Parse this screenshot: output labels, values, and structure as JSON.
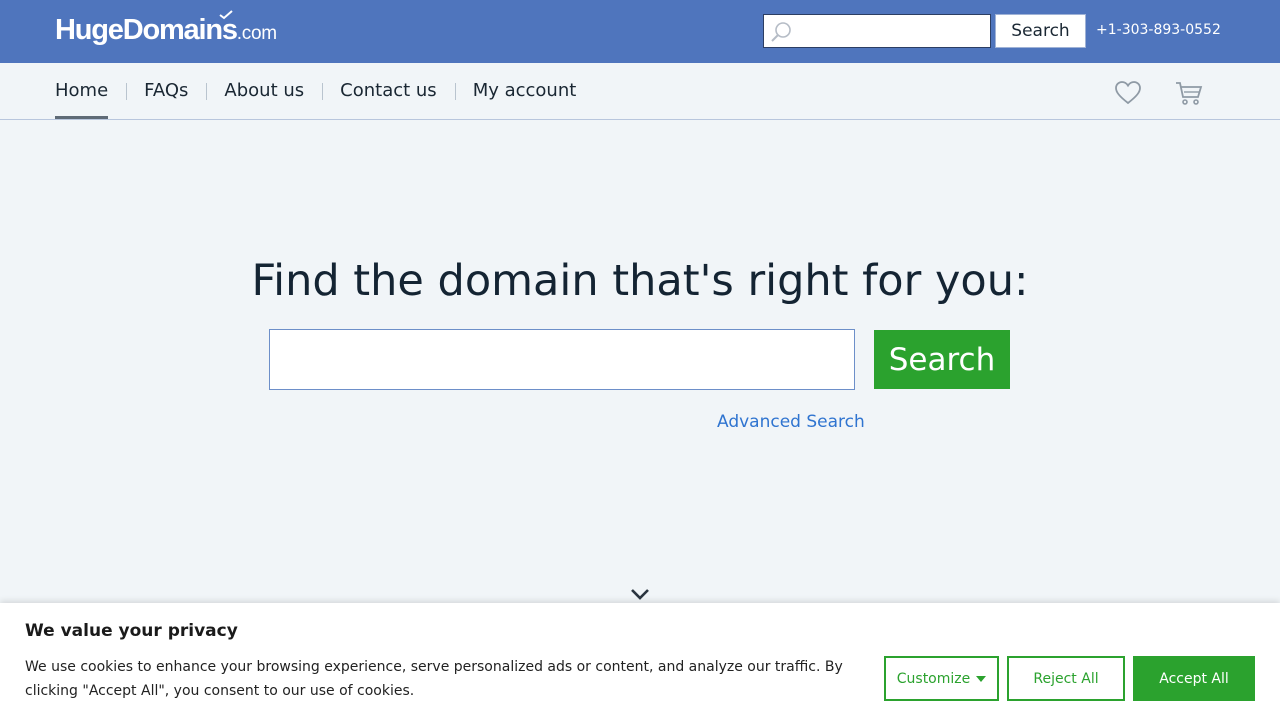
{
  "header": {
    "logo_main": "HugeDomains",
    "logo_suffix": ".com",
    "search_placeholder": "",
    "search_label": "Search",
    "phone": "+1-303-893-0552"
  },
  "nav": {
    "items": [
      {
        "label": "Home",
        "active": true
      },
      {
        "label": "FAQs"
      },
      {
        "label": "About us"
      },
      {
        "label": "Contact us"
      },
      {
        "label": "My account"
      }
    ]
  },
  "hero": {
    "title": "Find the domain that's right for you:",
    "search_value": "",
    "search_button": "Search",
    "advanced_link": "Advanced Search"
  },
  "cookie_banner": {
    "title": "We value your privacy",
    "text": "We use cookies to enhance your browsing experience, serve personalized ads or content, and analyze our traffic. By clicking \"Accept All\", you consent to our use of cookies.",
    "customize": "Customize",
    "reject": "Reject All",
    "accept": "Accept All"
  },
  "colors": {
    "header_bg": "#4f75bd",
    "accent_green": "#2ba22e",
    "link_blue": "#2f74d0",
    "page_bg": "#f1f5f8"
  },
  "icons": [
    "search-icon",
    "heart-icon",
    "cart-icon",
    "chevron-down-icon",
    "caret-down-icon"
  ]
}
